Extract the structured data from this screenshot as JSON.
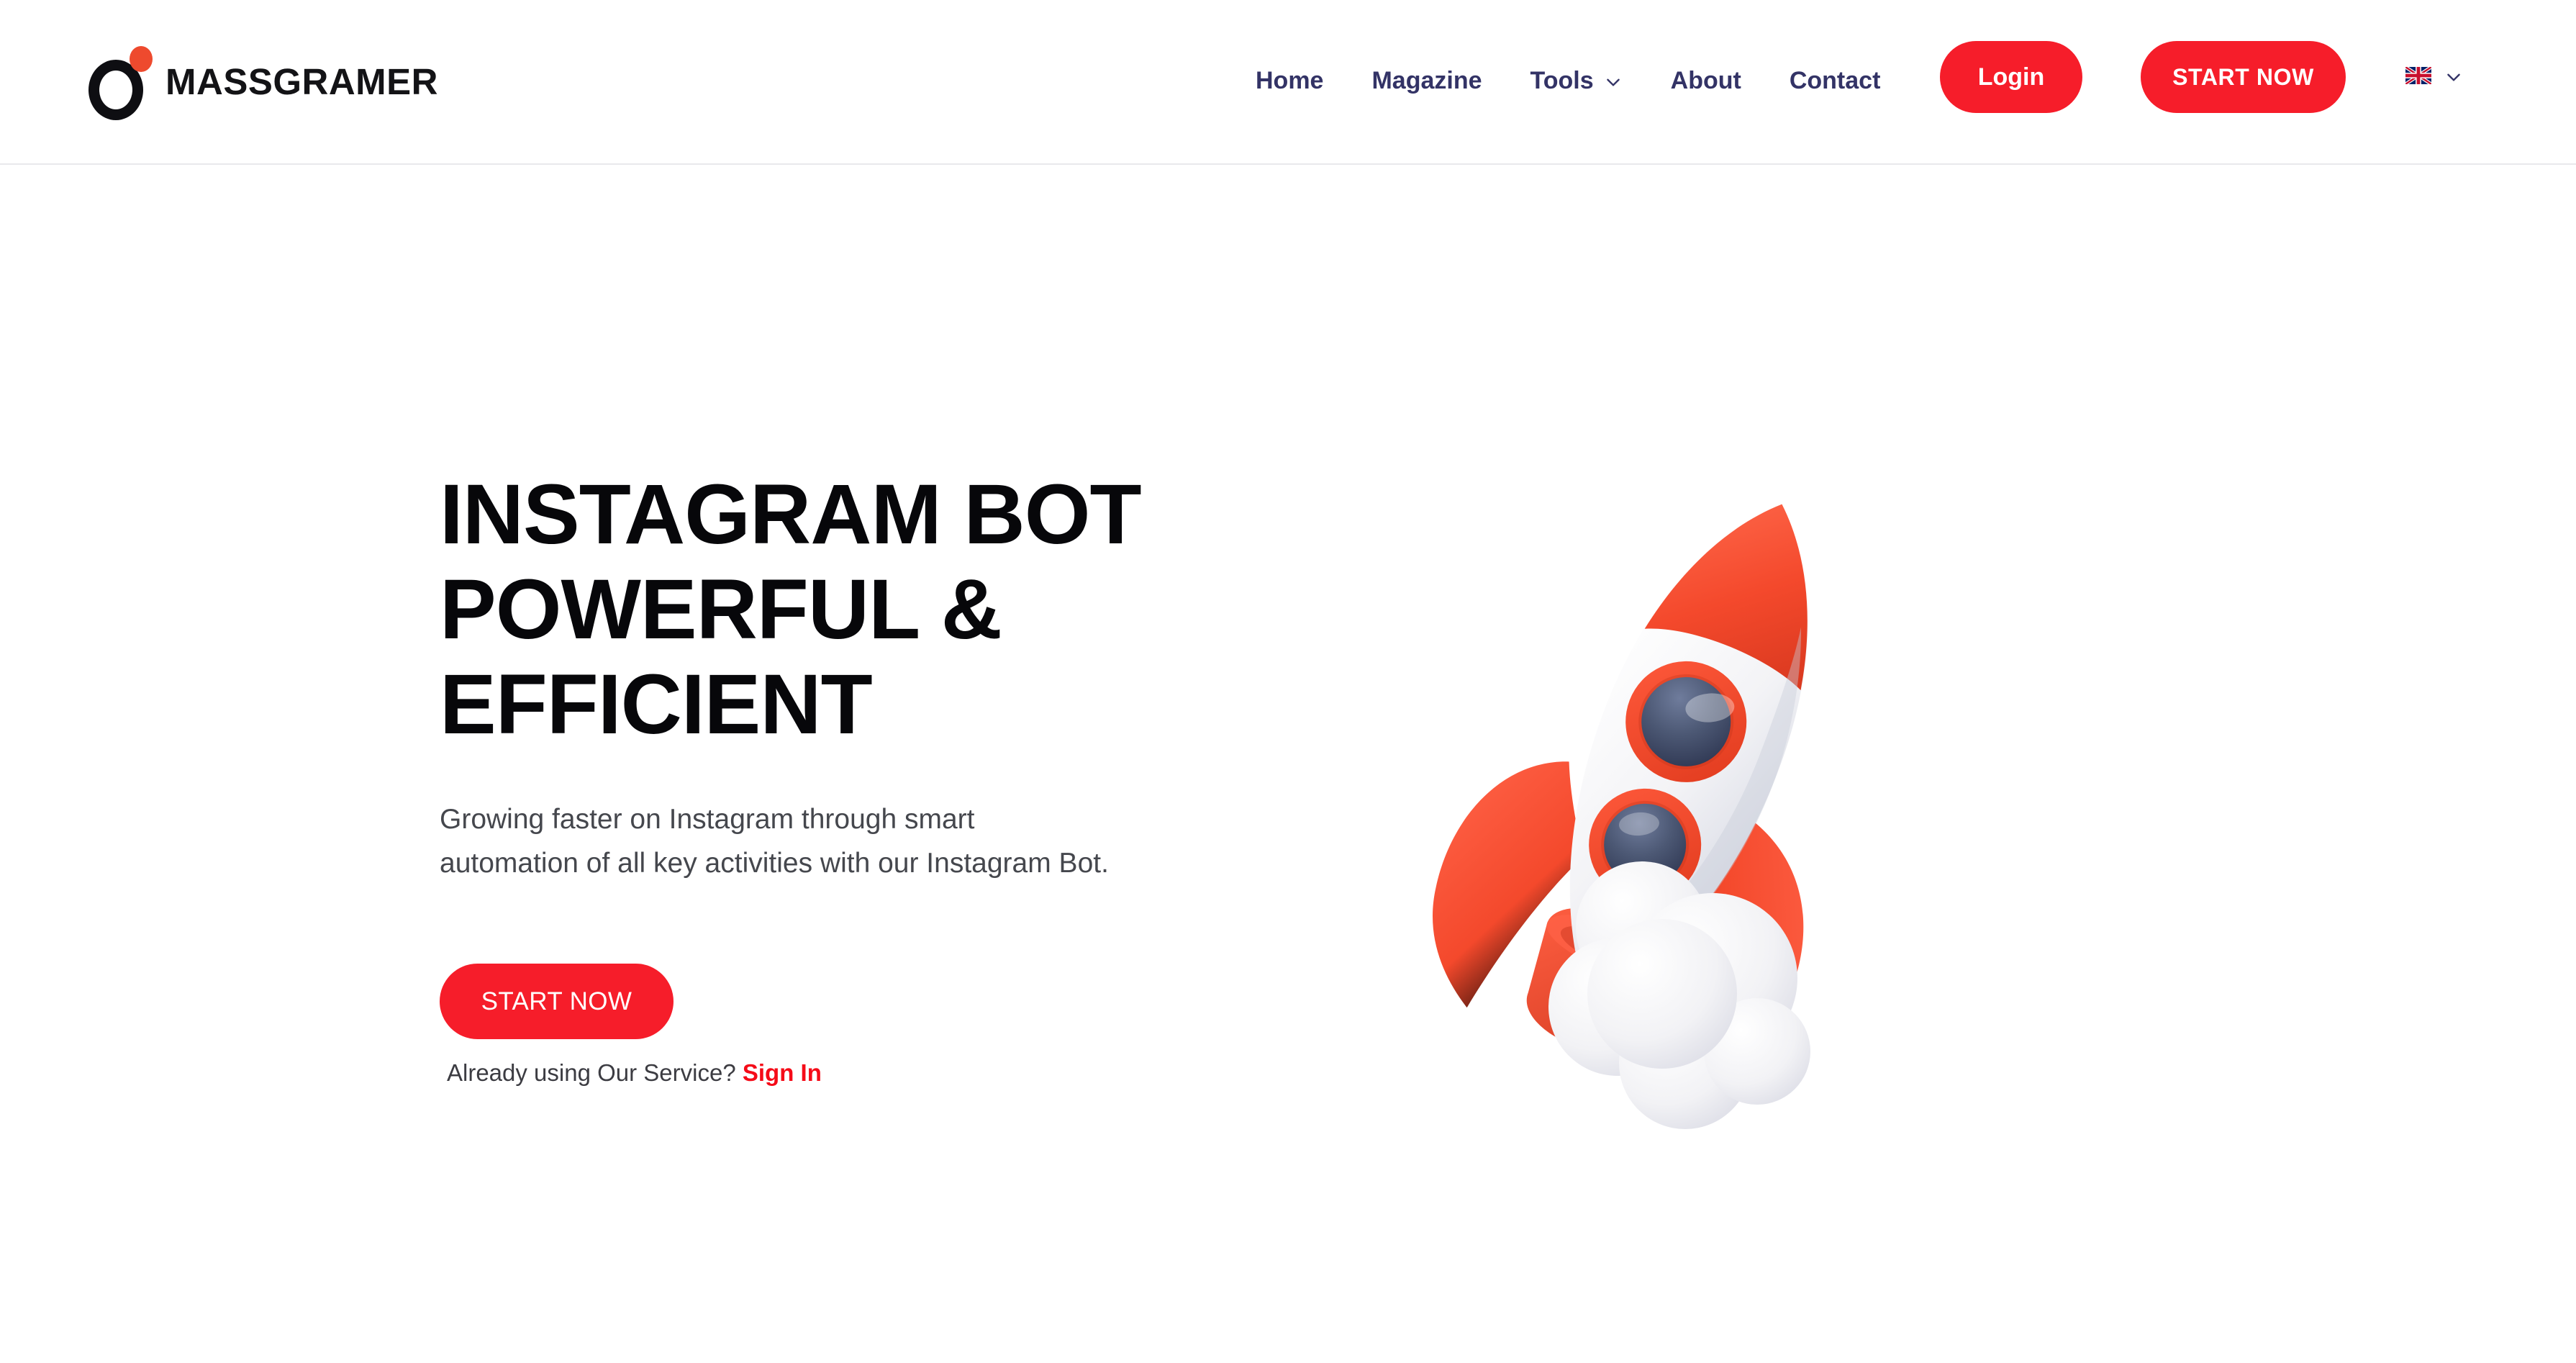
{
  "brand": {
    "name": "MASSGRAMER",
    "mark_ring_color": "#0e0e12",
    "mark_dot_color": "#ee4a2e"
  },
  "header": {
    "nav": [
      {
        "label": "Home",
        "has_dropdown": false
      },
      {
        "label": "Magazine",
        "has_dropdown": false
      },
      {
        "label": "Tools",
        "has_dropdown": true
      },
      {
        "label": "About",
        "has_dropdown": false
      },
      {
        "label": "Contact",
        "has_dropdown": false
      }
    ],
    "login_label": "Login",
    "start_now_label": "START NOW",
    "language": {
      "current": "en",
      "flag_icon": "uk-flag-icon",
      "chevron_icon": "chevron-down-icon"
    },
    "accent_color": "#f61d2a",
    "nav_text_color": "#333366",
    "border_color": "#e9e9ec"
  },
  "hero": {
    "title": "INSTAGRAM BOT POWERFUL & EFFICIENT",
    "subtitle": "Growing faster on Instagram through smart automation of all key activities with our Instagram Bot.",
    "cta_label": "START NOW",
    "signin_prompt": "Already using Our Service?",
    "signin_label": "Sign In",
    "signin_color": "#f50b18",
    "illustration": {
      "name": "rocket-illustration",
      "body_color": "#f4f4f6",
      "accent_color": "#f4492c",
      "window_color": "#3e4a68",
      "smoke_color": "#f0f0f3"
    }
  }
}
